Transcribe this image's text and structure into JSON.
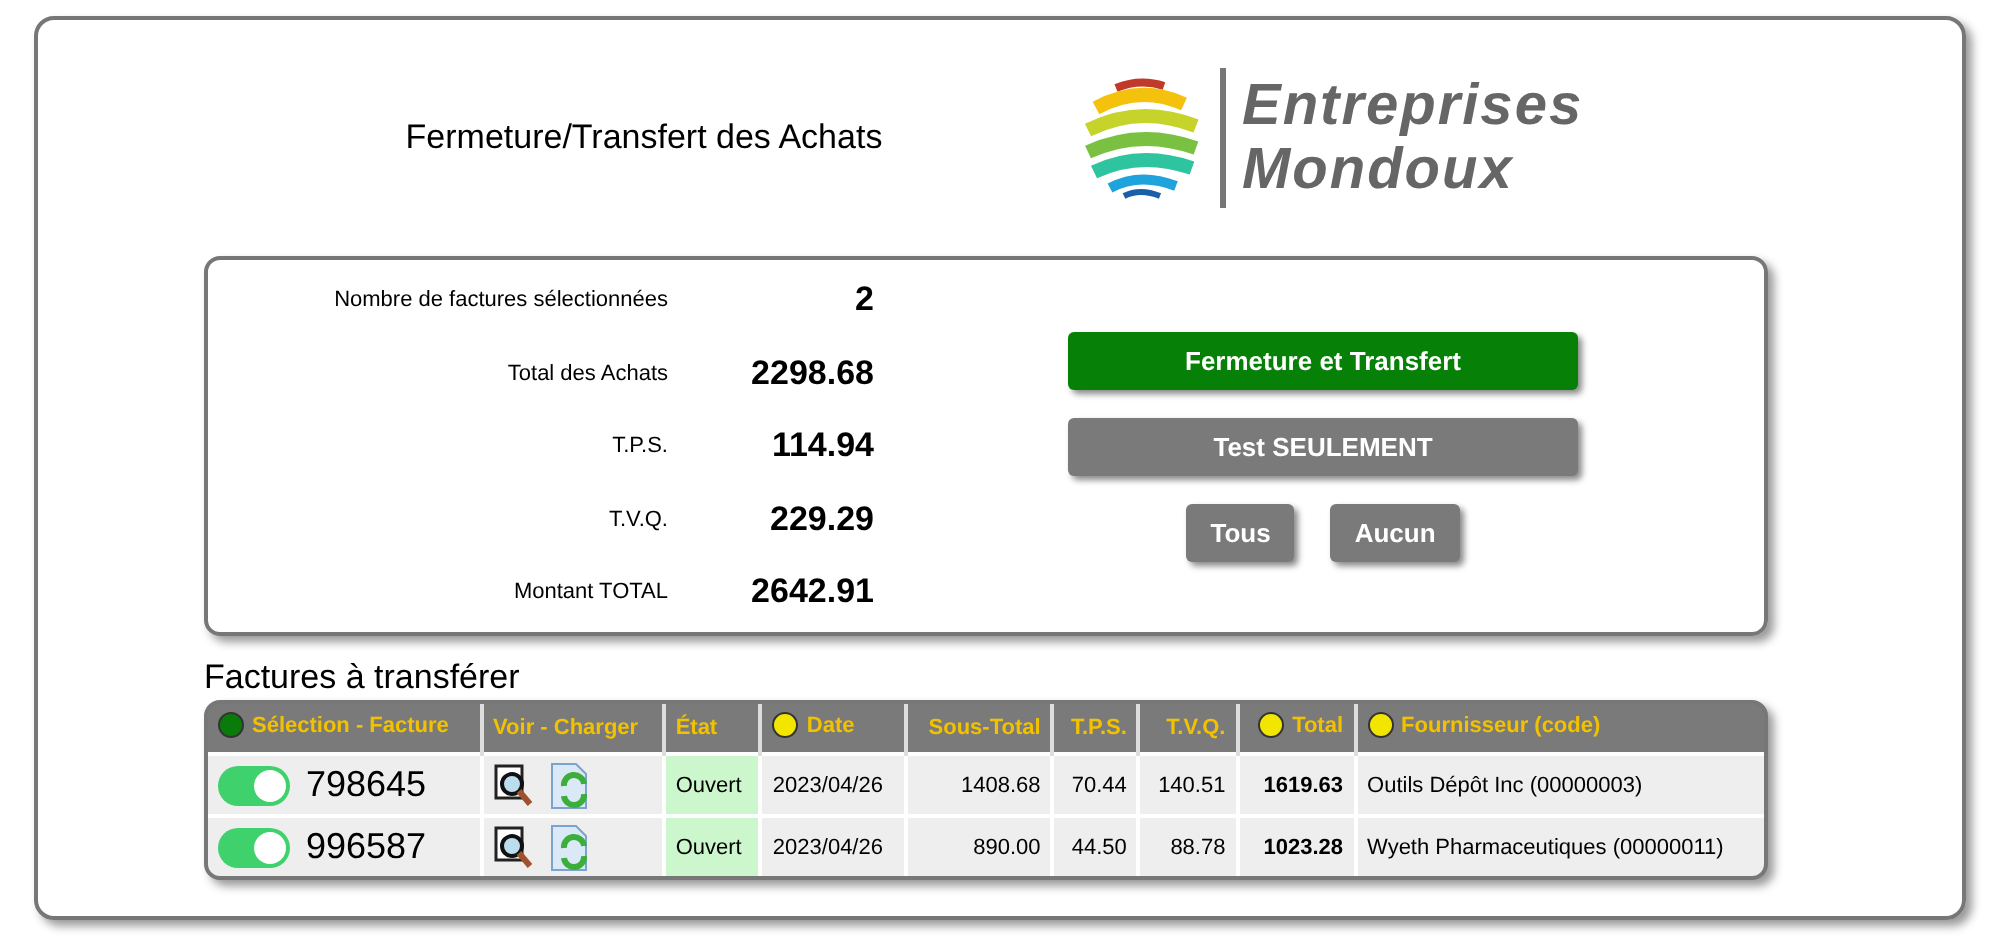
{
  "header": {
    "title": "Fermeture/Transfert des Achats",
    "logo_lines": [
      "Entreprises",
      "Mondoux"
    ]
  },
  "summary": {
    "rows": [
      {
        "label": "Nombre de factures sélectionnées",
        "value": "2"
      },
      {
        "label": "Total des Achats",
        "value": "2298.68"
      },
      {
        "label": "T.P.S.",
        "value": "114.94"
      },
      {
        "label": "T.V.Q.",
        "value": "229.29"
      },
      {
        "label": "Montant TOTAL",
        "value": "2642.91"
      }
    ],
    "buttons": [
      {
        "label": "Fermeture et Transfert",
        "kind": "primary"
      },
      {
        "label": "Test SEULEMENT",
        "kind": "secondary"
      }
    ],
    "small_buttons": [
      "Tous",
      "Aucun"
    ]
  },
  "table": {
    "title": "Factures à transférer",
    "columns": [
      {
        "label": "Sélection - Facture",
        "color": "#0a7a0a"
      },
      {
        "label": "Voir - Charger"
      },
      {
        "label": "État"
      },
      {
        "label": "Date",
        "color": "#f2e600"
      },
      {
        "label": "Sous-Total"
      },
      {
        "label": "T.P.S."
      },
      {
        "label": "T.V.Q."
      },
      {
        "label": "Total",
        "color": "#f2e600"
      },
      {
        "label": "Fournisseur (code)",
        "color": "#f2e600"
      }
    ],
    "rows": [
      {
        "on": true,
        "invoice": "798645",
        "state": "Ouvert",
        "date": "2023/04/26",
        "subtotal": "1408.68",
        "tps": "70.44",
        "tvq": "140.51",
        "total": "1619.63",
        "supplier": "Outils Dépôt Inc (00000003)"
      },
      {
        "on": true,
        "invoice": "996587",
        "state": "Ouvert",
        "date": "2023/04/26",
        "subtotal": "890.00",
        "tps": "44.50",
        "tvq": "88.78",
        "total": "1023.28",
        "supplier": "Wyeth Pharmaceutiques (00000011)"
      }
    ]
  }
}
